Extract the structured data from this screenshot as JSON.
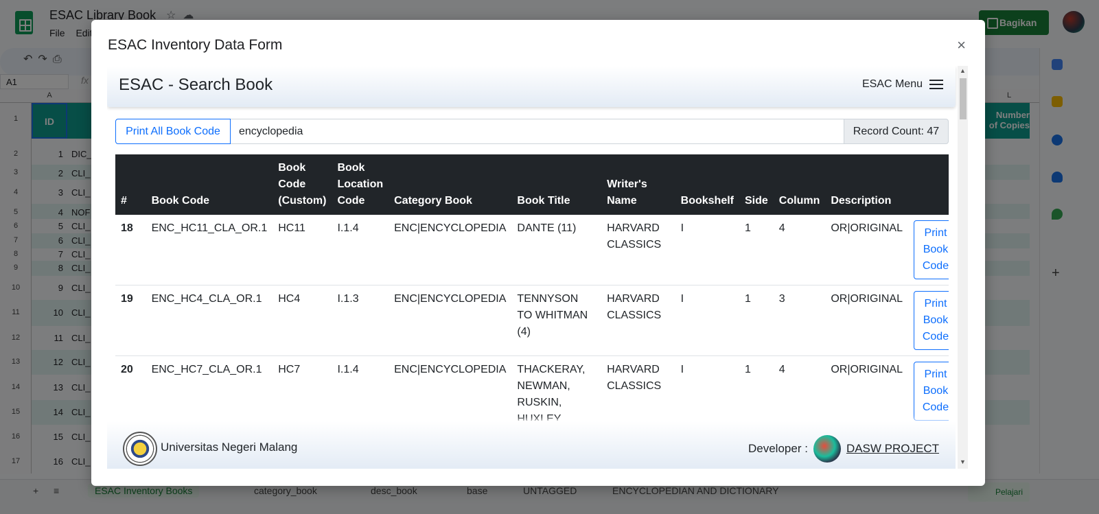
{
  "background": {
    "doc_title": "ESAC Library Book",
    "menu": [
      "File",
      "Edit"
    ],
    "share_label": "Bagikan",
    "namebox": "A1",
    "fx": "fx",
    "col_a": "A",
    "col_l": "L",
    "id_header": "ID",
    "numcopies": "Number\nof Copies",
    "rows": [
      {
        "n": "1",
        "id": "",
        "b": ""
      },
      {
        "n": "2",
        "id": "1",
        "b": "DIC_"
      },
      {
        "n": "3",
        "id": "2",
        "b": "CLI_"
      },
      {
        "n": "4",
        "id": "3",
        "b": "CLI_"
      },
      {
        "n": "5",
        "id": "4",
        "b": "NOF"
      },
      {
        "n": "6",
        "id": "5",
        "b": "CLI_"
      },
      {
        "n": "7",
        "id": "6",
        "b": "CLI_"
      },
      {
        "n": "8",
        "id": "7",
        "b": "CLI_"
      },
      {
        "n": "9",
        "id": "8",
        "b": "CLI_"
      },
      {
        "n": "10",
        "id": "9",
        "b": "CLI_"
      },
      {
        "n": "11",
        "id": "10",
        "b": "CLI_"
      },
      {
        "n": "12",
        "id": "11",
        "b": "CLI_"
      },
      {
        "n": "13",
        "id": "12",
        "b": "CLI_"
      },
      {
        "n": "14",
        "id": "13",
        "b": "CLI_"
      },
      {
        "n": "15",
        "id": "14",
        "b": "CLI_"
      },
      {
        "n": "16",
        "id": "15",
        "b": "CLI_"
      },
      {
        "n": "17",
        "id": "16",
        "b": "CLI_"
      }
    ],
    "tabs": [
      "ESAC Inventory Books",
      "category_book",
      "desc_book",
      "base",
      "UNTAGGED",
      "ENCYCLOPEDIAN AND DICTIONARY"
    ],
    "pelajari": "Pelajari"
  },
  "modal": {
    "title": "ESAC Inventory Data Form",
    "close": "×"
  },
  "app": {
    "title": "ESAC - Search Book",
    "menu_label": "ESAC Menu",
    "print_all_label": "Print All Book Code",
    "search_value": "encyclopedia",
    "record_count": "Record Count: 47",
    "table": {
      "headers": {
        "num": "#",
        "code": "Book Code",
        "custom": "Book Code (Custom)",
        "location": "Book Location Code",
        "category": "Category Book",
        "title": "Book Title",
        "writer": "Writer's Name",
        "shelf": "Bookshelf",
        "side": "Side",
        "column": "Column",
        "desc": "Description"
      },
      "rows": [
        {
          "num": "18",
          "code": "ENC_HC11_CLA_OR.1",
          "custom": "HC11",
          "location": "I.1.4",
          "category": "ENC|ENCYCLOPEDIA",
          "title": "DANTE (11)",
          "writer": "HARVARD CLASSICS",
          "shelf": "I",
          "side": "1",
          "column": "4",
          "desc": "OR|ORIGINAL",
          "btn": "Print Book Code"
        },
        {
          "num": "19",
          "code": "ENC_HC4_CLA_OR.1",
          "custom": "HC4",
          "location": "I.1.3",
          "category": "ENC|ENCYCLOPEDIA",
          "title": "TENNYSON TO WHITMAN (4)",
          "writer": "HARVARD CLASSICS",
          "shelf": "I",
          "side": "1",
          "column": "3",
          "desc": "OR|ORIGINAL",
          "btn": "Print Book Code"
        },
        {
          "num": "20",
          "code": "ENC_HC7_CLA_OR.1",
          "custom": "HC7",
          "location": "I.1.4",
          "category": "ENC|ENCYCLOPEDIA",
          "title": "THACKERAY, NEWMAN, RUSKIN, HUXLEY",
          "writer": "HARVARD CLASSICS",
          "shelf": "I",
          "side": "1",
          "column": "4",
          "desc": "OR|ORIGINAL",
          "btn": "Print Book Code"
        }
      ]
    },
    "footer": {
      "university": "Universitas Negeri Malang",
      "developer_label": "Developer :",
      "developer_link": "DASW PROJECT"
    }
  }
}
